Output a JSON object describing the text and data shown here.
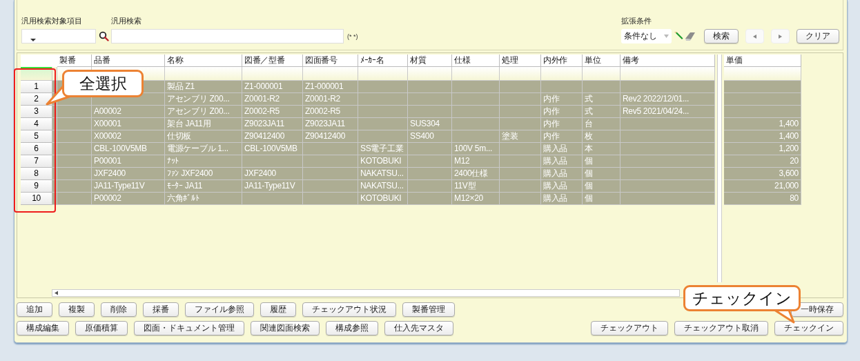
{
  "search": {
    "target_label": "汎用検索対象項目",
    "keyword_label": "汎用検索",
    "hint": "(* *)"
  },
  "extended": {
    "label": "拡張条件",
    "condition": "条件なし"
  },
  "search_buttons": [
    {
      "kind": "text",
      "label": "検索",
      "disabled": false
    },
    {
      "kind": "prev",
      "disabled": true
    },
    {
      "kind": "next",
      "disabled": true
    },
    {
      "kind": "text",
      "label": "クリア",
      "disabled": false
    }
  ],
  "grid": {
    "columns": [
      "製番",
      "品番",
      "名称",
      "図番／型番",
      "図面番号",
      "ﾒｰｶｰ名",
      "材質",
      "仕様",
      "処理",
      "内外作",
      "単位",
      "備考"
    ],
    "price_column": "単価",
    "rows": [
      {
        "number": "1",
        "selected": true,
        "cells": [
          null,
          null,
          "製品 Z1",
          "Z1-000001",
          "Z1-000001",
          null,
          null,
          null,
          null,
          null,
          null,
          null
        ]
      },
      {
        "number": "2",
        "selected": true,
        "cells": [
          null,
          null,
          "アセンブリ Z00...",
          "Z0001-R2",
          "Z0001-R2",
          null,
          null,
          null,
          null,
          "内作",
          "式",
          "Rev2 2022/12/01..."
        ]
      },
      {
        "number": "3",
        "selected": true,
        "cells": [
          null,
          "A00002",
          "アセンブリ Z00...",
          "Z0002-R5",
          "Z0002-R5",
          null,
          null,
          null,
          null,
          "内作",
          "式",
          "Rev5 2021/04/24..."
        ]
      },
      {
        "number": "4",
        "selected": true,
        "cells": [
          null,
          "X00001",
          "架台 JA11用",
          "Z9023JA11",
          "Z9023JA11",
          null,
          "SUS304",
          null,
          null,
          "内作",
          "台",
          null
        ],
        "price": "1,400"
      },
      {
        "number": "5",
        "selected": true,
        "cells": [
          null,
          "X00002",
          "仕切板",
          "Z90412400",
          "Z90412400",
          null,
          "SS400",
          null,
          "塗装",
          "内作",
          "枚",
          null
        ],
        "price": "1,400"
      },
      {
        "number": "6",
        "selected": true,
        "cells": [
          null,
          "CBL-100V5MB",
          "電源ケーブル 1...",
          "CBL-100V5MB",
          null,
          "SS電子工業",
          null,
          "100V 5m...",
          null,
          "購入品",
          "本",
          null
        ],
        "price": "1,200"
      },
      {
        "number": "7",
        "selected": true,
        "cells": [
          null,
          "P00001",
          "ﾅｯﾄ",
          null,
          null,
          "KOTOBUKI",
          null,
          "M12",
          null,
          "購入品",
          "個",
          null
        ],
        "price": "20"
      },
      {
        "number": "8",
        "selected": true,
        "cells": [
          null,
          "JXF2400",
          "ﾌｧﾝ JXF2400",
          "JXF2400",
          null,
          "NAKATSU...",
          null,
          "2400仕様",
          null,
          "購入品",
          "個",
          null
        ],
        "price": "3,600"
      },
      {
        "number": "9",
        "selected": true,
        "cells": [
          null,
          "JA11-Type11V",
          "ﾓｰﾀｰ JA11",
          "JA11-Type11V",
          null,
          "NAKATSU...",
          null,
          "11V型",
          null,
          "購入品",
          "個",
          null
        ],
        "price": "21,000"
      },
      {
        "number": "10",
        "selected": true,
        "cells": [
          null,
          "P00002",
          "六角ﾎﾞﾙﾄ",
          null,
          null,
          "KOTOBUKI",
          null,
          "M12×20",
          null,
          "購入品",
          "個",
          null
        ],
        "price": "80"
      }
    ]
  },
  "buttons_row1": [
    "追加",
    "複製",
    "削除",
    "採番",
    "ファイル参照",
    "履歴",
    "チェックアウト状況",
    "製番管理"
  ],
  "buttons_row2": [
    "構成編集",
    "原価積算",
    "図面・ドキュメント管理",
    "関連図面検索",
    "構成参照",
    "仕入先マスタ"
  ],
  "right_row1": [
    "一時保存"
  ],
  "right_row2": [
    "チェックアウト",
    "チェックアウト取消",
    "チェックイン"
  ],
  "callouts": [
    {
      "text": "全選択"
    },
    {
      "text": "チェックイン"
    }
  ]
}
